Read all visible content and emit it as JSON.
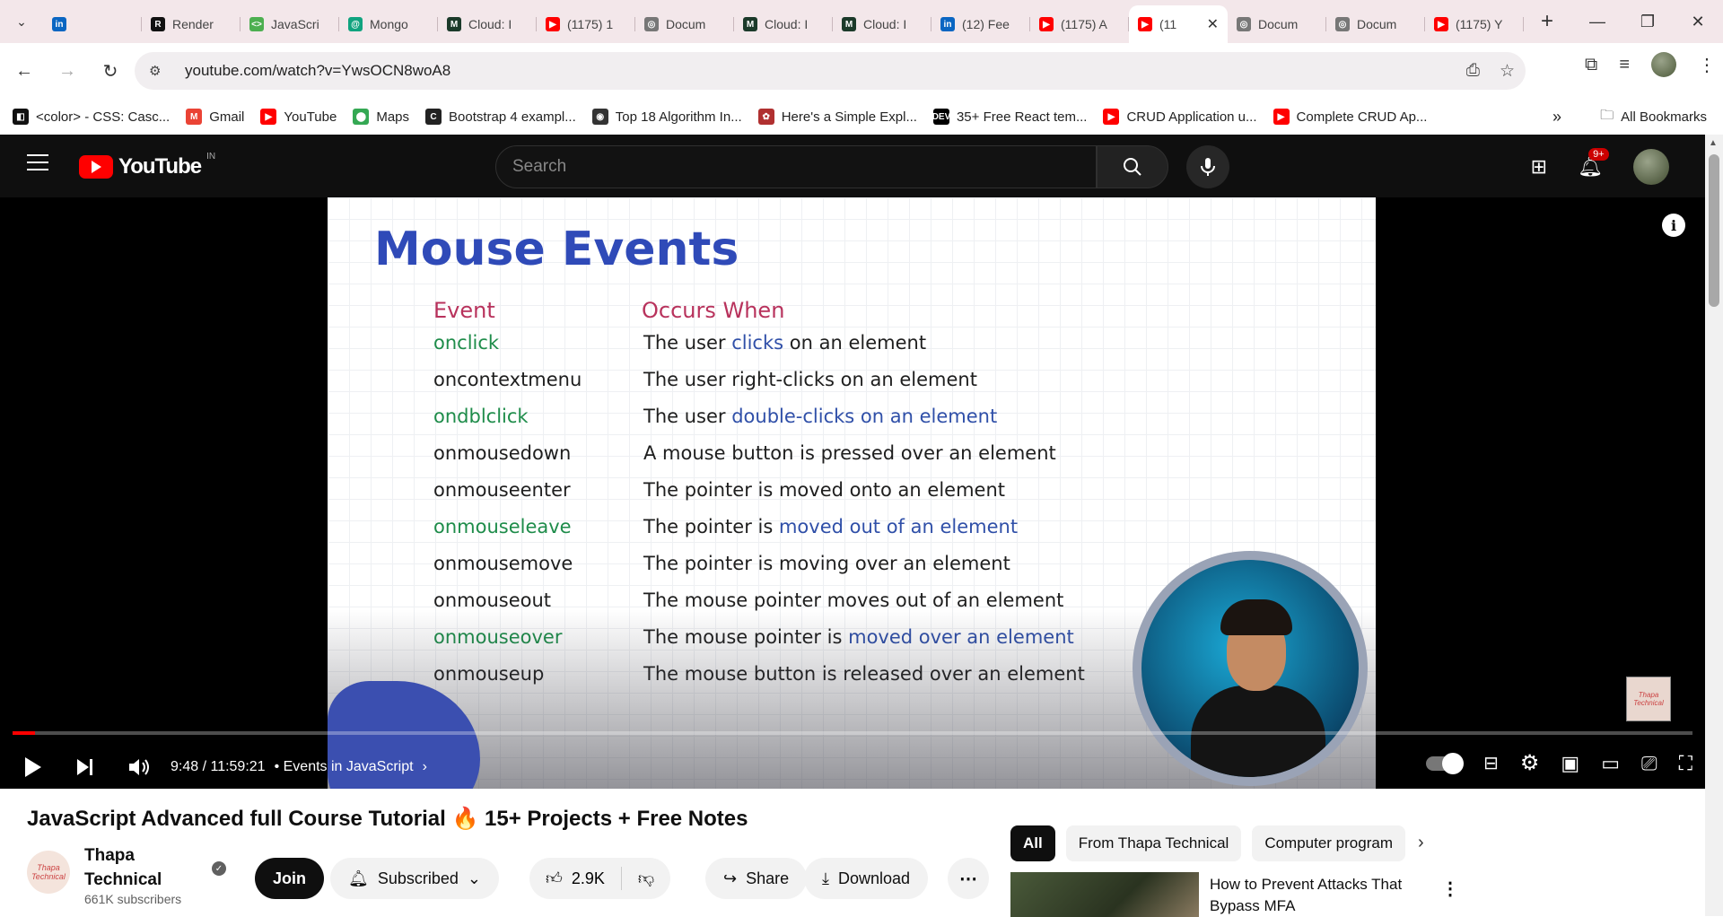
{
  "browser": {
    "tabs": [
      {
        "label": "",
        "favicon": "linkedin",
        "color": "#0a66c2",
        "glyph": "in"
      },
      {
        "label": "Render",
        "favicon": "render",
        "color": "#111111",
        "glyph": "R"
      },
      {
        "label": "JavaScri",
        "favicon": "codepen",
        "color": "#4caf50",
        "glyph": "<>"
      },
      {
        "label": "Mongo",
        "favicon": "chatgpt",
        "color": "#10a37f",
        "glyph": "@"
      },
      {
        "label": "Cloud: I",
        "favicon": "mongodb",
        "color": "#1b3a2a",
        "glyph": "M"
      },
      {
        "label": "(1175) 1",
        "favicon": "youtube",
        "color": "#ff0000",
        "glyph": "▶"
      },
      {
        "label": "Docum",
        "favicon": "globe",
        "color": "#777777",
        "glyph": "◎"
      },
      {
        "label": "Cloud: I",
        "favicon": "mongodb",
        "color": "#1b3a2a",
        "glyph": "M"
      },
      {
        "label": "Cloud: I",
        "favicon": "mongodb",
        "color": "#1b3a2a",
        "glyph": "M"
      },
      {
        "label": "(12) Fee",
        "favicon": "linkedin",
        "color": "#0a66c2",
        "glyph": "in"
      },
      {
        "label": "(1175) A",
        "favicon": "youtube",
        "color": "#ff0000",
        "glyph": "▶"
      },
      {
        "label": "(11",
        "favicon": "youtube",
        "color": "#ff0000",
        "glyph": "▶",
        "active": true
      },
      {
        "label": "Docum",
        "favicon": "globe",
        "color": "#777777",
        "glyph": "◎"
      },
      {
        "label": "Docum",
        "favicon": "globe",
        "color": "#777777",
        "glyph": "◎"
      },
      {
        "label": "(1175) Y",
        "favicon": "youtube",
        "color": "#ff0000",
        "glyph": "▶"
      }
    ],
    "url": "youtube.com/watch?v=YwsOCN8woA8",
    "bookmarks": [
      {
        "label": "<color> - CSS: Casc...",
        "color": "#111111",
        "glyph": "◧"
      },
      {
        "label": "Gmail",
        "color": "#ea4335",
        "glyph": "M"
      },
      {
        "label": "YouTube",
        "color": "#ff0000",
        "glyph": "▶"
      },
      {
        "label": "Maps",
        "color": "#34a853",
        "glyph": "⬤"
      },
      {
        "label": "Bootstrap 4 exampl...",
        "color": "#222222",
        "glyph": "C"
      },
      {
        "label": "Top 18 Algorithm In...",
        "color": "#333333",
        "glyph": "◉"
      },
      {
        "label": "Here's a Simple Expl...",
        "color": "#b03030",
        "glyph": "✿"
      },
      {
        "label": "35+ Free React tem...",
        "color": "#000000",
        "glyph": "DEV"
      },
      {
        "label": "CRUD Application u...",
        "color": "#ff0000",
        "glyph": "▶"
      },
      {
        "label": "Complete CRUD Ap...",
        "color": "#ff0000",
        "glyph": "▶"
      }
    ],
    "all_bookmarks": "All Bookmarks"
  },
  "youtube": {
    "country_code": "IN",
    "search_placeholder": "Search",
    "notification_badge": "9+"
  },
  "slide": {
    "title": "Mouse Events",
    "col_event": "Event",
    "col_occurs": "Occurs When",
    "rows": [
      {
        "event": "onclick",
        "green": true,
        "pre": "The user ",
        "hl": "clicks",
        "post": " on an element"
      },
      {
        "event": "oncontextmenu",
        "green": false,
        "pre": "The user right-clicks on an element",
        "hl": "",
        "post": ""
      },
      {
        "event": "ondblclick",
        "green": true,
        "pre": "The user ",
        "hl": "double-clicks on an element",
        "post": ""
      },
      {
        "event": "onmousedown",
        "green": false,
        "pre": "A mouse button is pressed over an element",
        "hl": "",
        "post": ""
      },
      {
        "event": "onmouseenter",
        "green": false,
        "pre": "The pointer is moved onto an element",
        "hl": "",
        "post": ""
      },
      {
        "event": "onmouseleave",
        "green": true,
        "pre": "The pointer is ",
        "hl": "moved out of an element",
        "post": ""
      },
      {
        "event": "onmousemove",
        "green": false,
        "pre": "The pointer is moving over an element",
        "hl": "",
        "post": ""
      },
      {
        "event": "onmouseout",
        "green": false,
        "pre": "The mouse pointer moves out of an element",
        "hl": "",
        "post": ""
      },
      {
        "event": "onmouseover",
        "green": true,
        "pre": "The mouse pointer is ",
        "hl": "moved over an element",
        "post": ""
      },
      {
        "event": "onmouseup",
        "green": false,
        "pre": "The mouse button is released over an element",
        "hl": "",
        "post": ""
      }
    ],
    "watermark_text": "Thapa Technical"
  },
  "player": {
    "time": "9:48 / 11:59:21",
    "chapter": "• Events in JavaScript",
    "progress_fraction": 0.0136
  },
  "video": {
    "title": "JavaScript Advanced full Course Tutorial 🔥 15+ Projects + Free Notes",
    "channel": "Thapa Technical",
    "subscribers": "661K subscribers",
    "join": "Join",
    "subscribed": "Subscribed",
    "likes": "2.9K",
    "share": "Share",
    "download": "Download"
  },
  "sidebar": {
    "chips": [
      "All",
      "From Thapa Technical",
      "Computer program"
    ],
    "recommendation_title": "How to Prevent Attacks That Bypass MFA"
  },
  "colors": {
    "accent_red": "#ff0000",
    "slide_title": "#2f4ab8",
    "slide_header": "#b8325c",
    "event_green": "#1e8c4a",
    "highlight_blue": "#2f4fa8"
  }
}
